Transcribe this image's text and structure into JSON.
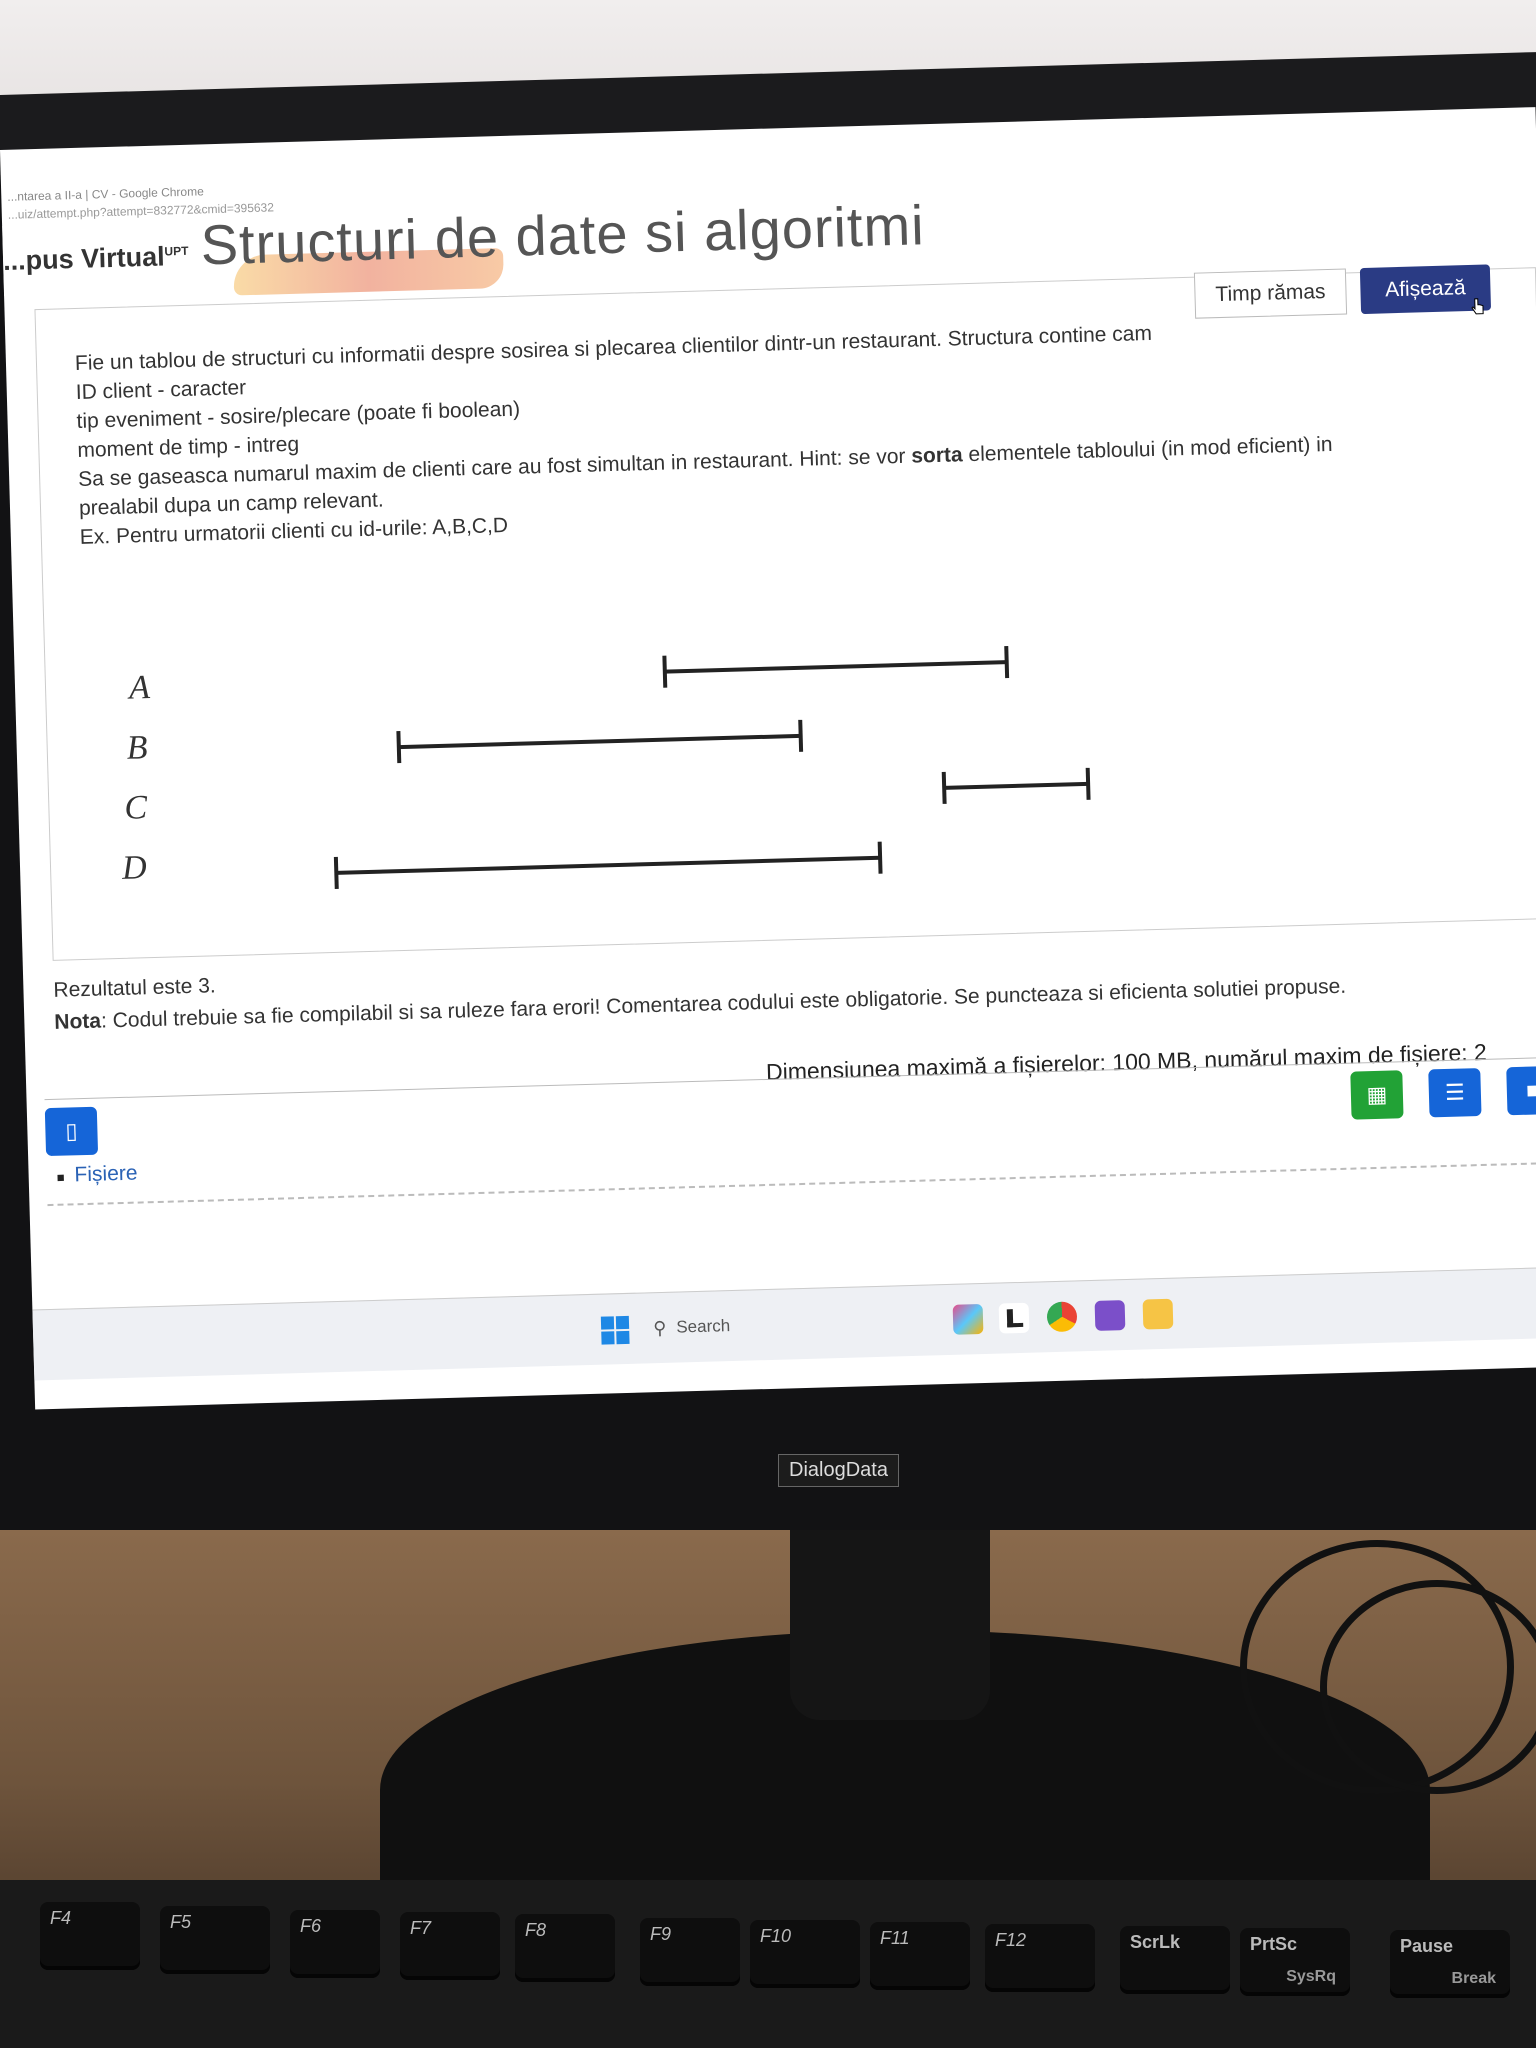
{
  "browser": {
    "window_title": "...ntarea a II-a | CV - Google Chrome",
    "url": "...uiz/attempt.php?attempt=832772&cmid=395632"
  },
  "header": {
    "brand": "...pus Virtual",
    "brand_sup": "UPT",
    "course_title": "Structuri de date si algoritmi"
  },
  "question": {
    "line1": "Fie un tablou de structuri cu informatii despre sosirea si plecarea clientilor dintr-un restaurant. Structura contine cam",
    "line2": "ID client - caracter",
    "line3": "tip eveniment - sosire/plecare (poate fi boolean)",
    "line4": "moment de timp - intreg",
    "line5_pre": "Sa se gaseasca numarul maxim de clienti care au fost simultan in restaurant. Hint: se vor ",
    "line5_bold": "sorta",
    "line5_post": " elementele tabloului (in mod eficient) in",
    "line6": "prealabil dupa un camp relevant.",
    "line7": "Ex. Pentru urmatorii clienti cu id-urile: A,B,C,D"
  },
  "timer": {
    "label": "Timp rămas",
    "button": "Afișează"
  },
  "diagram": {
    "labels": [
      "A",
      "B",
      "C",
      "D"
    ]
  },
  "result_text": "Rezultatul este 3.",
  "note": {
    "bold": "Nota",
    "text": ": Codul trebuie sa fie compilabil si sa ruleze fara erori! Comentarea codului este obligatorie. Se puncteaza si eficienta solutiei propuse."
  },
  "files": {
    "info": "Dimensiunea maximă a fișierelor: 100 MB, numărul maxim de fișiere: 2",
    "link": "Fișiere"
  },
  "taskbar": {
    "search": "Search"
  },
  "monitor": {
    "brand": "DialogData"
  },
  "keyboard": {
    "keys": [
      "F4",
      "F5",
      "F6",
      "F7",
      "F8",
      "F9",
      "F10",
      "F11",
      "F12",
      "ScrLk",
      "PrtSc",
      "Pause"
    ],
    "prtsc_sub": "SysRq",
    "pause_sub": "Break"
  },
  "colors": {
    "primary_button": "#2a3b84",
    "green_button": "#22a236",
    "blue_button": "#1565d8",
    "link": "#2a62b5"
  }
}
